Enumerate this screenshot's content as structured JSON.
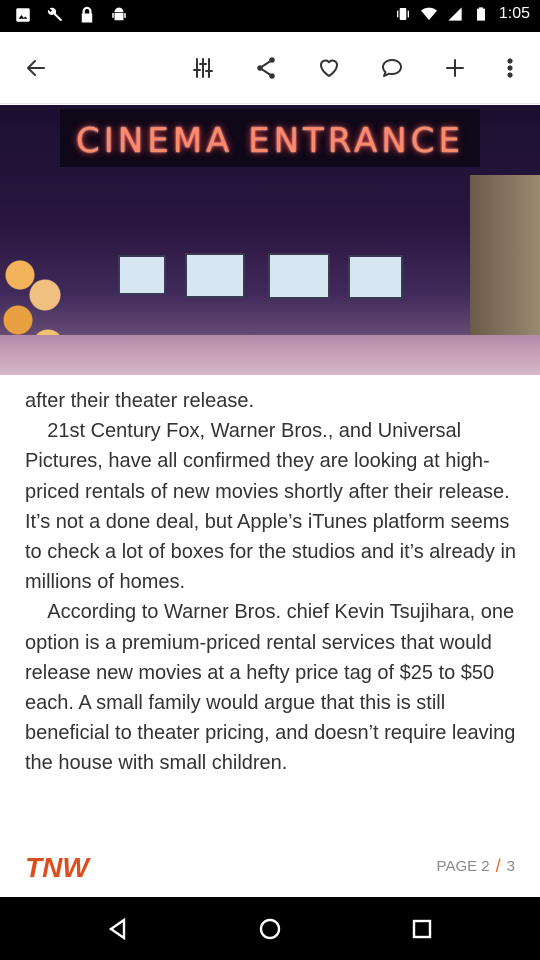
{
  "status_bar": {
    "time": "1:05",
    "left_icons": [
      "photo-icon",
      "wrench-icon",
      "lock-icon",
      "android-icon"
    ],
    "right_icons": [
      "vibrate-icon",
      "wifi-icon",
      "signal-icon",
      "battery-icon"
    ]
  },
  "toolbar": {
    "icons": [
      "back-arrow-icon",
      "equalizer-icon",
      "share-icon",
      "heart-icon",
      "comment-icon",
      "plus-icon",
      "more-vert-icon"
    ]
  },
  "hero": {
    "sign_text": "CINEMA ENTRANCE"
  },
  "article": {
    "paragraph_1": "after their theater release.",
    "paragraph_2": "    21st Century Fox, Warner Bros., and Universal Pictures, have all confirmed they are looking at high-priced rentals of new movies shortly after their release. It’s not a done deal, but Apple’s iTunes platform seems to check a lot of boxes for the studios and it’s already in millions of homes.",
    "paragraph_3": "    According to Warner Bros. chief Kevin Tsujihara, one option is a premium-priced rental services that would release new movies at a hefty price tag of $25 to $50 each. A small family would argue that this is still beneficial to theater pricing, and doesn’t require leaving the house with small children."
  },
  "footer": {
    "logo_text": "TNW",
    "page_label": "PAGE 2",
    "page_slash": "/",
    "page_total": "3"
  },
  "nav_bar": {
    "icons": [
      "back-triangle-icon",
      "home-circle-icon",
      "recents-square-icon"
    ]
  },
  "colors": {
    "accent": "#e86a20",
    "logo": "#d9501e",
    "text": "#333333",
    "muted": "#8a8a8a"
  }
}
